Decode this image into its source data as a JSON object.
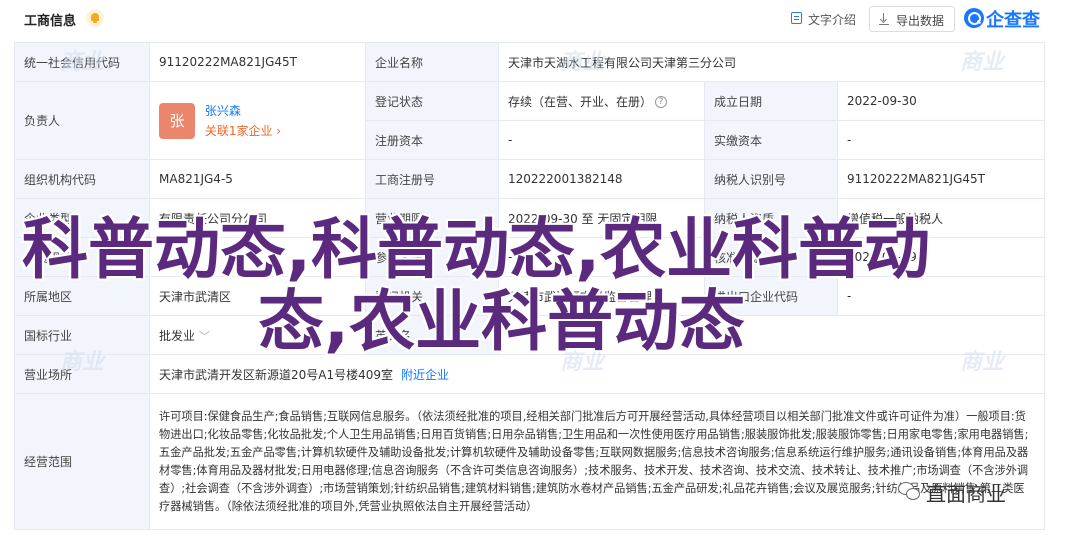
{
  "header": {
    "title": "工商信息",
    "bell_icon": "bell-icon",
    "intro_label": "文字介绍",
    "export_label": "导出数据",
    "logo_text": "企查查"
  },
  "rows": {
    "credit_code": {
      "label": "统一社会信用代码",
      "value": "91120222MA821JG45T"
    },
    "company_name": {
      "label": "企业名称",
      "value": "天津市天湖水工程有限公司天津第三分公司"
    },
    "legal_rep": {
      "label": "负责人",
      "avatar_char": "张",
      "name": "张兴森",
      "related": "关联1家企业",
      "related_chevron": "›"
    },
    "reg_status": {
      "label": "登记状态",
      "value": "存续（在营、开业、在册）"
    },
    "established": {
      "label": "成立日期",
      "value": "2022-09-30"
    },
    "reg_capital": {
      "label": "注册资本",
      "value": "-"
    },
    "paid_capital": {
      "label": "实缴资本",
      "value": "-"
    },
    "org_code": {
      "label": "组织机构代码",
      "value": "MA821JG4-5"
    },
    "biz_reg_no": {
      "label": "工商注册号",
      "value": "120222001382148"
    },
    "taxpayer_id": {
      "label": "纳税人识别号",
      "value": "91120222MA821JG45T"
    },
    "company_type": {
      "label": "企业类型",
      "value": "有限责任公司分公司"
    },
    "biz_term": {
      "label": "营业期限",
      "value": "2022-09-30 至 无固定期限"
    },
    "taxpayer_qual": {
      "label": "纳税人资质",
      "value": "增值税一般纳税人"
    },
    "staff": {
      "label": "人员规模",
      "value": "-"
    },
    "insured": {
      "label": "参保人数",
      "value": "-"
    },
    "approval_date": {
      "label": "核准日期",
      "value": "2022-09-19"
    },
    "region": {
      "label": "所属地区",
      "value": "天津市武清区"
    },
    "authority": {
      "label": "登记机关",
      "value": "天津市武清区市场监督管理局"
    },
    "import_export": {
      "label": "进出口企业代码",
      "value": "-"
    },
    "industry": {
      "label": "国标行业",
      "value": "批发业"
    },
    "english_name": {
      "label": "英文名",
      "value": "-"
    },
    "address": {
      "label": "营业场所",
      "value": "天津市武清开发区新源道20号A1号楼409室",
      "link": "附近企业"
    },
    "scope": {
      "label": "经营范围",
      "value": "许可项目:保健食品生产;食品销售;互联网信息服务。（依法须经批准的项目,经相关部门批准后方可开展经营活动,具体经营项目以相关部门批准文件或许可证件为准）一般项目:货物进出口;化妆品零售;化妆品批发;个人卫生用品销售;日用百货销售;日用杂品销售;卫生用品和一次性使用医疗用品销售;服装服饰批发;服装服饰零售;日用家电零售;家用电器销售;五金产品批发;五金产品零售;计算机软硬件及辅助设备批发;计算机软硬件及辅助设备零售;互联网数据服务;信息技术咨询服务;信息系统运行维护服务;通讯设备销售;体育用品及器材零售;体育用品及器材批发;日用电器修理;信息咨询服务（不含许可类信息咨询服务）;技术服务、技术开发、技术咨询、技术交流、技术转让、技术推广;市场调查（不含涉外调查）;社会调查（不含涉外调查）;市场营销策划;针纺织品销售;建筑材料销售;建筑防水卷材产品销售;五金产品研发;礼品花卉销售;会议及展览服务;针纺织品及原料销售;第二类医疗器械销售。（除依法须经批准的项目外,凭营业执照依法自主开展经营活动）"
    }
  },
  "watermark": "商业",
  "overlay": {
    "line1": "科普动态,科普动态,农业科普动",
    "line2": "态,农业科普动态"
  },
  "wechat": {
    "icon": "wechat-icon",
    "text": "直面商业"
  }
}
